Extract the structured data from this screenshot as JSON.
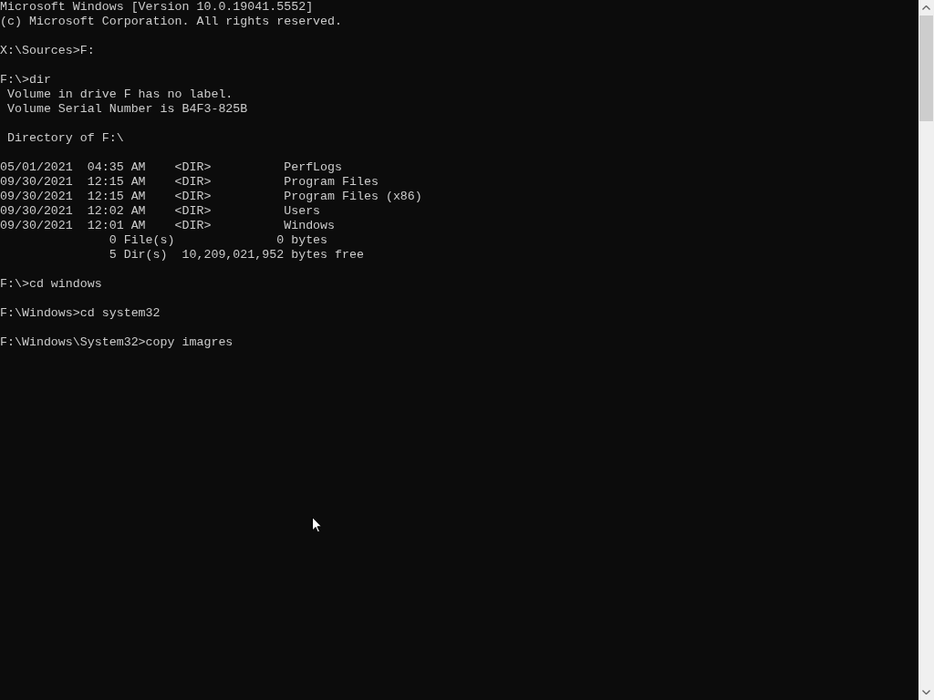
{
  "console": {
    "blocks": [
      [
        "Microsoft Windows [Version 10.0.19041.5552]",
        "(c) Microsoft Corporation. All rights reserved."
      ],
      [
        "X:\\Sources>F:"
      ],
      [
        "F:\\>dir",
        " Volume in drive F has no label.",
        " Volume Serial Number is B4F3-825B"
      ],
      [
        " Directory of F:\\"
      ],
      [
        "05/01/2021  04:35 AM    <DIR>          PerfLogs",
        "09/30/2021  12:15 AM    <DIR>          Program Files",
        "09/30/2021  12:15 AM    <DIR>          Program Files (x86)",
        "09/30/2021  12:02 AM    <DIR>          Users",
        "09/30/2021  12:01 AM    <DIR>          Windows",
        "               0 File(s)              0 bytes",
        "               5 Dir(s)  10,209,021,952 bytes free"
      ],
      [
        "F:\\>cd windows"
      ],
      [
        "F:\\Windows>cd system32"
      ],
      [
        "F:\\Windows\\System32>copy imagres"
      ]
    ]
  }
}
